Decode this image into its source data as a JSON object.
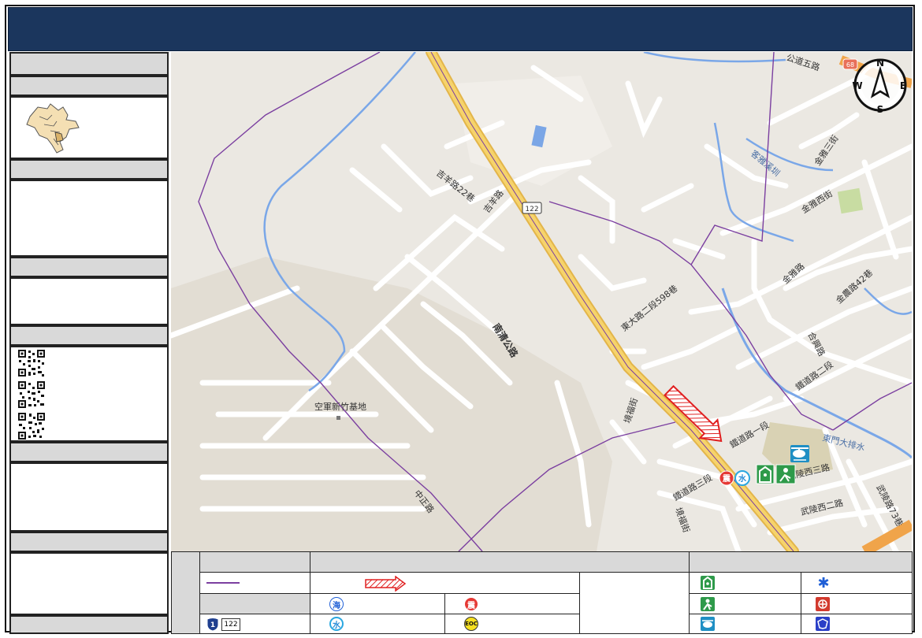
{
  "map": {
    "labels": {
      "airbase": "空軍新竹基地",
      "road_nanqing": "南清公路",
      "road_jifeng": "吉羊路",
      "road_jifeng22": "吉羊路22巷",
      "road_zhongzheng": "中正路",
      "road_dongda598": "東大路二段598巷",
      "road_jingfu": "境福街",
      "road_jingfu_s": "境福街",
      "road_tiedao1": "鐵道路一段",
      "road_tiedao2": "鐵道路二段",
      "road_tiedao3": "鐵道路三段",
      "road_wuling3": "武陵西三路",
      "road_wuling2": "武陵西二路",
      "road_wuling73": "武陵路73巷",
      "road_jinya3": "金雅三街",
      "road_jinyaxi": "金雅西街",
      "road_jinya": "金雅路",
      "road_jinnong42": "金農路42巷",
      "road_hexing": "合興路",
      "road_gongdao5": "公道五路",
      "river_kexie": "客雅溪圳",
      "river_dongmen": "東門大排水",
      "shield_122": "122",
      "shield_68": "68",
      "badge_quake": "震",
      "badge_water": "水"
    },
    "compass": {
      "n": "N",
      "s": "S",
      "e": "E",
      "w": "W"
    }
  },
  "legend": {
    "shield_122": "122",
    "sym_sea": "海",
    "sym_quake": "震",
    "sym_water": "水",
    "sym_eoc": "EOC"
  },
  "colors": {
    "title_bg": "#1b365d",
    "panel_head": "#d9d9d9",
    "boundary": "#7b3fa0",
    "highway": "#f2c94c",
    "river": "#7aa7e8",
    "arrow": "#e02020"
  }
}
